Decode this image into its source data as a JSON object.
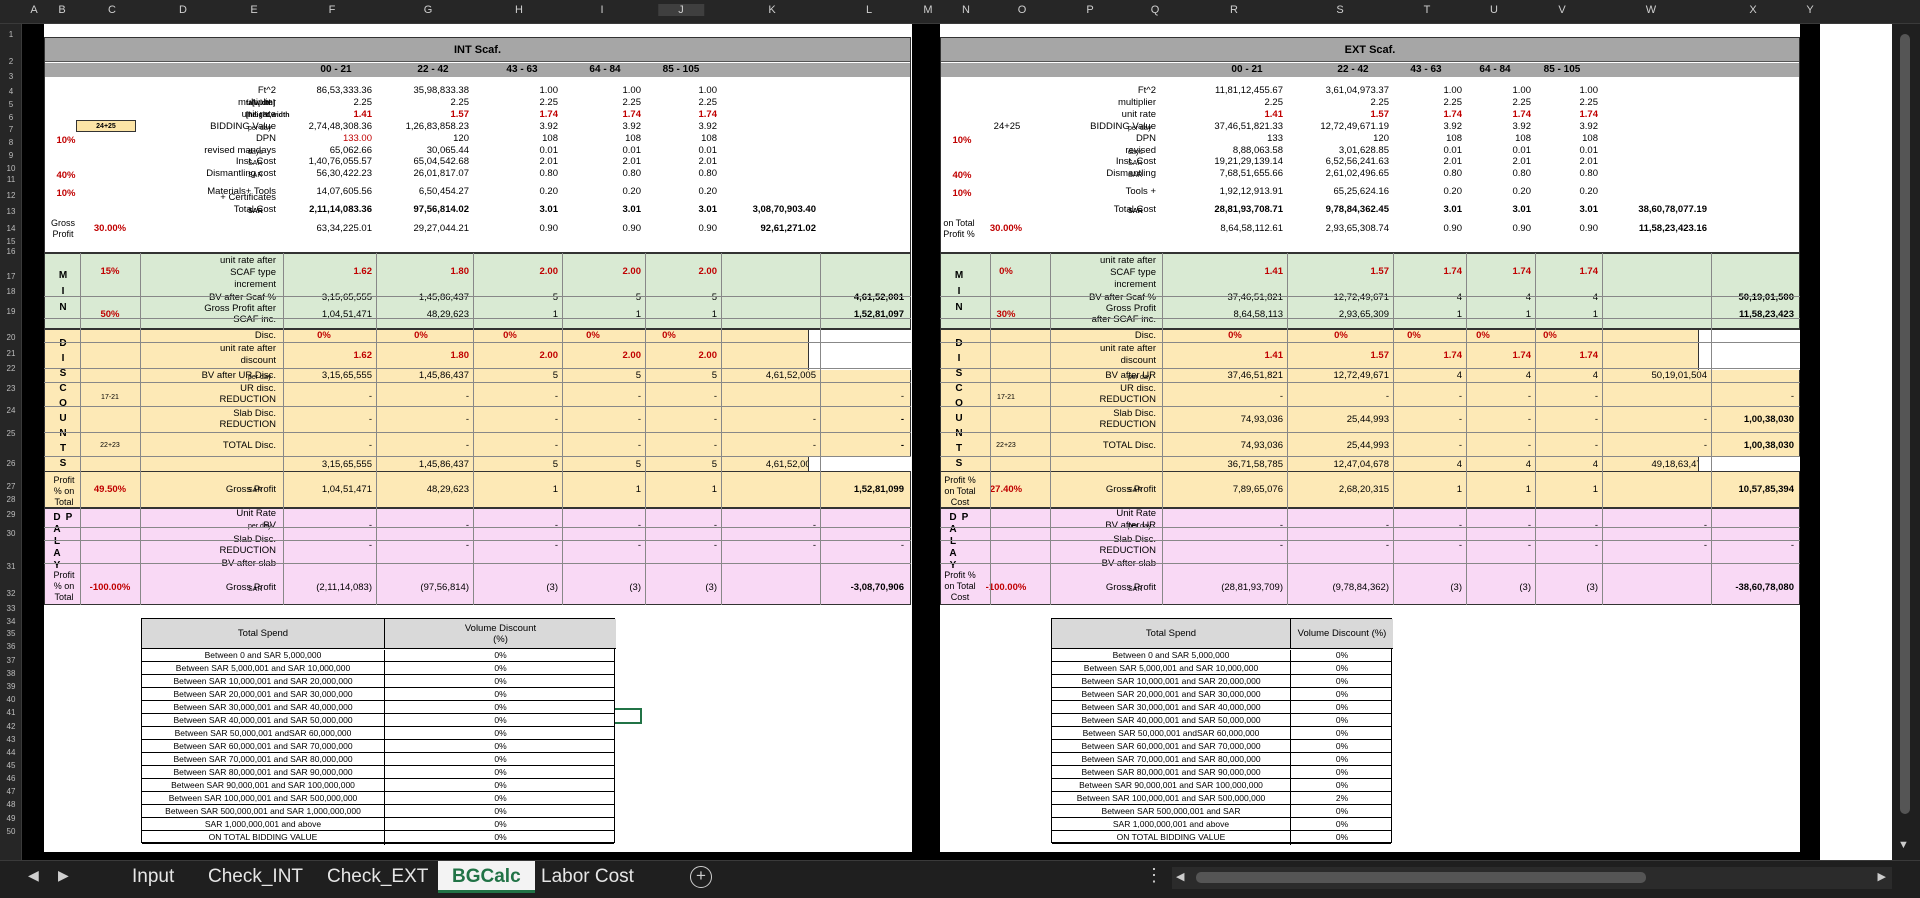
{
  "columns": [
    "A",
    "B",
    "C",
    "D",
    "E",
    "F",
    "G",
    "H",
    "I",
    "J",
    "K",
    "L",
    "M",
    "N",
    "O",
    "P",
    "Q",
    "R",
    "S",
    "T",
    "U",
    "V",
    "W",
    "X",
    "Y"
  ],
  "rows": [
    "1",
    "2",
    "3",
    "4",
    "5",
    "6",
    "7",
    "8",
    "9",
    "10",
    "11",
    "12",
    "13",
    "14",
    "15",
    "16",
    "17",
    "18",
    "19",
    "20",
    "21",
    "22",
    "23",
    "24",
    "25",
    "26",
    "27",
    "28",
    "29",
    "30",
    "31",
    "32",
    "33",
    "34",
    "35",
    "36",
    "37",
    "38",
    "39",
    "40",
    "41",
    "42",
    "43",
    "44",
    "45",
    "46",
    "47",
    "48",
    "49",
    "50"
  ],
  "int": {
    "title": "INT Scaf.",
    "ranges": [
      "00 - 21",
      "22 - 42",
      "43 - 63",
      "64 - 84",
      "85 - 105"
    ],
    "labels": {
      "ft2": "Ft^2",
      "multiplier": "multiplier",
      "unit_rate": "unit rate",
      "bidding": "BIDDING Value",
      "dpn": "DPN",
      "mandays": "revised mandays",
      "inst": "Inst. Cost",
      "dismantling": "Dismantling cost",
      "materials": "Materials+ Tools",
      "certs": "+ Certificates",
      "total": "Total Cost",
      "gross_row": "Gross Profit",
      "gross_left": "Gross",
      "gross_left2": "Profit"
    },
    "units": {
      "fa_width": "fa[width]",
      "height_width": "[height,width",
      "per_day": "per day",
      "days": "days",
      "sar": "SAR"
    },
    "tag": "24+25",
    "pcts": {
      "p10": "10%",
      "p40": "40%",
      "p10b": "10%",
      "gp": "30.00%"
    },
    "rows": {
      "ft2": [
        "86,53,333.36",
        "35,98,833.38",
        "1.00",
        "1.00",
        "1.00"
      ],
      "multiplier": [
        "2.25",
        "2.25",
        "2.25",
        "2.25",
        "2.25"
      ],
      "unit_rate": [
        "1.41",
        "1.57",
        "1.74",
        "1.74",
        "1.74"
      ],
      "bidding": [
        "2,74,48,308.36",
        "1,26,83,858.23",
        "3.92",
        "3.92",
        "3.92"
      ],
      "dpn": [
        "133.00",
        "120",
        "108",
        "108",
        "108"
      ],
      "mandays": [
        "65,062.66",
        "30,065.44",
        "0.01",
        "0.01",
        "0.01"
      ],
      "inst": [
        "1,40,76,055.57",
        "65,04,542.68",
        "2.01",
        "2.01",
        "2.01"
      ],
      "dismantling": [
        "56,30,422.23",
        "26,01,817.07",
        "0.80",
        "0.80",
        "0.80"
      ],
      "materials": [
        "14,07,605.56",
        "6,50,454.27",
        "0.20",
        "0.20",
        "0.20"
      ],
      "total": [
        "2,11,14,083.36",
        "97,56,814.02",
        "3.01",
        "3.01",
        "3.01",
        "3,08,70,903.40"
      ],
      "gross": [
        "63,34,225.01",
        "29,27,044.21",
        "0.90",
        "0.90",
        "0.90",
        "92,61,271.02"
      ]
    },
    "min": {
      "letters": [
        "M",
        "I",
        "N"
      ],
      "pct1": "15%",
      "pct2": "50%",
      "label1": "unit rate after",
      "label2": "SCAF type",
      "label3": "increment",
      "label4": "BV after Scaf %",
      "label5": "Gross Profit after",
      "label6": "SCAF inc.",
      "rate": [
        "1.62",
        "1.80",
        "2.00",
        "2.00",
        "2.00"
      ],
      "bv": [
        "3,15,65,555",
        "1,45,86,437",
        "5",
        "5",
        "5",
        "4,61,52,001"
      ],
      "gp": [
        "1,04,51,471",
        "48,29,623",
        "1",
        "1",
        "1",
        "1,52,81,097"
      ]
    },
    "disc": {
      "letters": [
        "D",
        "I",
        "S",
        "C",
        "O",
        "U",
        "N",
        "T",
        "S"
      ],
      "disc_label": "Disc.",
      "disc": [
        "0%",
        "0%",
        "0%",
        "0%",
        "0%"
      ],
      "rate_label1": "unit rate after",
      "rate_label2": "discount",
      "rate": [
        "1.62",
        "1.80",
        "2.00",
        "2.00",
        "2.00"
      ],
      "bvur_label": "BV after UR Disc.",
      "bvur": [
        "3,15,65,555",
        "1,45,86,437",
        "5",
        "5",
        "5",
        "4,61,52,005"
      ],
      "urd_tag": "17-21",
      "urd_label1": "UR disc.",
      "urd_label2": "REDUCTION",
      "urd": [
        "-",
        "-",
        "-",
        "-",
        "-",
        "-"
      ],
      "slab_label1": "Slab Disc.",
      "slab_label2": "REDUCTION",
      "slab": [
        "-",
        "-",
        "-",
        "-",
        "-",
        "-",
        "-"
      ],
      "total_tag": "22+23",
      "total_label": "TOTAL Disc.",
      "total": [
        "-",
        "-",
        "-",
        "-",
        "-",
        "-",
        "-"
      ],
      "bvslab": [
        "3,15,65,555",
        "1,45,86,437",
        "5",
        "5",
        "5",
        "4,61,52,005"
      ],
      "pct": "49.50%",
      "gp_label": "Gross Profit",
      "gp": [
        "1,04,51,471",
        "48,29,623",
        "1",
        "1",
        "1",
        "1,52,81,099"
      ],
      "left1": "Profit",
      "left2": "% on",
      "left3": "Total"
    },
    "dp": {
      "letters_l": [
        "D",
        "A",
        "L",
        "A",
        "Y"
      ],
      "letters_r": [
        "P",
        "",
        "",
        "",
        ""
      ],
      "unit_rate": "Unit Rate",
      "bv": "BV",
      "slab1": "Slab Disc.",
      "slab2": "REDUCTION",
      "bvslab": "BV after slab",
      "dash": [
        "-",
        "-",
        "-",
        "-",
        "-",
        "-"
      ],
      "pct": "-100.00%",
      "gp_label": "Gross Profit",
      "gp": [
        "(2,11,14,083)",
        "(97,56,814)",
        "(3)",
        "(3)",
        "(3)",
        "-3,08,70,906"
      ]
    }
  },
  "ext": {
    "title": "EXT Scaf.",
    "ranges": [
      "00 - 21",
      "22 - 42",
      "43 - 63",
      "64 - 84",
      "85 - 105"
    ],
    "tag": "24+25",
    "pcts": {
      "p10": "10%",
      "p40": "40%",
      "p10b": "10%",
      "gp": "30.00%"
    },
    "labels": {
      "ft2": "Ft^2",
      "multiplier": "multiplier",
      "unit_rate": "unit rate",
      "bidding": "BIDDING Value",
      "dpn": "DPN",
      "mandays": "revised",
      "inst": "Inst. Cost",
      "dismantling": "Dismantling",
      "materials": "Tools +",
      "total": "Total Cost",
      "gross_row": "Gross Profit",
      "gross_left": "on Total",
      "gross_left2": "Profit %"
    },
    "rows": {
      "ft2": [
        "11,81,12,455.67",
        "3,61,04,973.37",
        "1.00",
        "1.00",
        "1.00"
      ],
      "multiplier": [
        "2.25",
        "2.25",
        "2.25",
        "2.25",
        "2.25"
      ],
      "unit_rate": [
        "1.41",
        "1.57",
        "1.74",
        "1.74",
        "1.74"
      ],
      "bidding": [
        "37,46,51,821.33",
        "12,72,49,671.19",
        "3.92",
        "3.92",
        "3.92"
      ],
      "dpn": [
        "133",
        "120",
        "108",
        "108",
        "108"
      ],
      "mandays": [
        "8,88,063.58",
        "3,01,628.85",
        "0.01",
        "0.01",
        "0.01"
      ],
      "inst": [
        "19,21,29,139.14",
        "6,52,56,241.63",
        "2.01",
        "2.01",
        "2.01"
      ],
      "dismantling": [
        "7,68,51,655.66",
        "2,61,02,496.65",
        "0.80",
        "0.80",
        "0.80"
      ],
      "materials": [
        "1,92,12,913.91",
        "65,25,624.16",
        "0.20",
        "0.20",
        "0.20"
      ],
      "total": [
        "28,81,93,708.71",
        "9,78,84,362.45",
        "3.01",
        "3.01",
        "3.01",
        "38,60,78,077.19"
      ],
      "gross": [
        "8,64,58,112.61",
        "2,93,65,308.74",
        "0.90",
        "0.90",
        "0.90",
        "11,58,23,423.16"
      ]
    },
    "min": {
      "pct1": "0%",
      "pct2": "30%",
      "label1": "unit rate after",
      "label2": "SCAF type",
      "label3": "increment",
      "label4": "BV after Scaf %",
      "label5": "Gross Profit",
      "label6": "after SCAF inc.",
      "rate": [
        "1.41",
        "1.57",
        "1.74",
        "1.74",
        "1.74"
      ],
      "bv": [
        "37,46,51,821",
        "12,72,49,671",
        "4",
        "4",
        "4",
        "50,19,01,500"
      ],
      "gp": [
        "8,64,58,113",
        "2,93,65,309",
        "1",
        "1",
        "1",
        "11,58,23,423"
      ]
    },
    "disc": {
      "disc": [
        "0%",
        "0%",
        "0%",
        "0%",
        "0%"
      ],
      "rate": [
        "1.41",
        "1.57",
        "1.74",
        "1.74",
        "1.74"
      ],
      "bvur_label": "BV after UR",
      "bvur": [
        "37,46,51,821",
        "12,72,49,671",
        "4",
        "4",
        "4",
        "50,19,01,504"
      ],
      "urd": [
        "-",
        "-",
        "-",
        "-",
        "-",
        "-"
      ],
      "slab": [
        "74,93,036",
        "25,44,993",
        "-",
        "-",
        "-",
        "-",
        "1,00,38,030"
      ],
      "total": [
        "74,93,036",
        "25,44,993",
        "-",
        "-",
        "-",
        "-",
        "1,00,38,030"
      ],
      "bvslab": [
        "36,71,58,785",
        "12,47,04,678",
        "4",
        "4",
        "4",
        "49,18,63,474"
      ],
      "pct": "27.40%",
      "gp": [
        "7,89,65,076",
        "2,68,20,315",
        "1",
        "1",
        "1",
        "10,57,85,394"
      ],
      "left1": "Profit %",
      "left2": "on Total",
      "left3": "Cost"
    },
    "dp": {
      "bv": "BV after UR",
      "gp": [
        "(28,81,93,709)",
        "(9,78,84,362)",
        "(3)",
        "(3)",
        "(3)",
        "-38,60,78,080"
      ],
      "pct": "-100.00%"
    }
  },
  "volume_int": {
    "h1": "Total Spend",
    "h2": "Volume Discount",
    "h3": "(%)",
    "rows": [
      [
        "Between 0 and SAR 5,000,000",
        "0%"
      ],
      [
        "Between SAR 5,000,001 and  SAR 10,000,000",
        "0%"
      ],
      [
        "Between SAR 10,000,001 and SAR 20,000,000",
        "0%"
      ],
      [
        "Between SAR 20,000,001 and SAR 30,000,000",
        "0%"
      ],
      [
        "Between SAR 30,000,001 and SAR 40,000,000",
        "0%"
      ],
      [
        "Between SAR 40,000,001 and SAR 50,000,000",
        "0%"
      ],
      [
        "Between SAR 50,000,001 andSAR 60,000,000",
        "0%"
      ],
      [
        "Between SAR 60,000,001 and SAR 70,000,000",
        "0%"
      ],
      [
        "Between SAR 70,000,001 and SAR 80,000,000",
        "0%"
      ],
      [
        "Between SAR 80,000,001 and SAR 90,000,000",
        "0%"
      ],
      [
        "Between SAR 90,000,001 and SAR 100,000,000",
        "0%"
      ],
      [
        "Between SAR 100,000,001 and SAR 500,000,000",
        "0%"
      ],
      [
        "Between SAR 500,000,001 and SAR 1,000,000,000",
        "0%"
      ],
      [
        "SAR 1,000,000,001 and above",
        "0%"
      ],
      [
        "ON TOTAL BIDDING VALUE",
        "0%"
      ]
    ]
  },
  "volume_ext": {
    "h1": "Total Spend",
    "h2": "Volume Discount (%)",
    "rows": [
      [
        "Between 0 and SAR 5,000,000",
        "0%"
      ],
      [
        "Between SAR 5,000,001 and  SAR 10,000,000",
        "0%"
      ],
      [
        "Between SAR 10,000,001 and SAR 20,000,000",
        "0%"
      ],
      [
        "Between SAR 20,000,001 and SAR 30,000,000",
        "0%"
      ],
      [
        "Between SAR 30,000,001 and SAR 40,000,000",
        "0%"
      ],
      [
        "Between SAR 40,000,001 and SAR 50,000,000",
        "0%"
      ],
      [
        "Between SAR 50,000,001 andSAR 60,000,000",
        "0%"
      ],
      [
        "Between SAR 60,000,001 and SAR 70,000,000",
        "0%"
      ],
      [
        "Between SAR 70,000,001 and SAR 80,000,000",
        "0%"
      ],
      [
        "Between SAR 80,000,001 and SAR 90,000,000",
        "0%"
      ],
      [
        "Between SAR 90,000,001 and SAR 100,000,000",
        "0%"
      ],
      [
        "Between SAR 100,000,001 and SAR 500,000,000",
        "2%"
      ],
      [
        "Between SAR 500,000,001 and SAR",
        "0%"
      ],
      [
        "SAR 1,000,000,001 and above",
        "0%"
      ],
      [
        "ON TOTAL BIDDING VALUE",
        "0%"
      ]
    ]
  },
  "tabs": [
    "Input",
    "Check_INT",
    "Check_EXT",
    "BGCalc",
    "Labor Cost"
  ],
  "active_tab": "BGCalc",
  "icons": {
    "prev": "left-arrow-icon",
    "next": "right-arrow-icon",
    "add": "add-sheet-icon",
    "more": "more-icon"
  },
  "colors": {
    "min_green": "#d9ead3",
    "disc_orange": "#fde9b6",
    "dp_pink": "#f9d9f5",
    "band_gray": "#a6a6a6",
    "accent": "#217346",
    "red": "#c00000"
  }
}
